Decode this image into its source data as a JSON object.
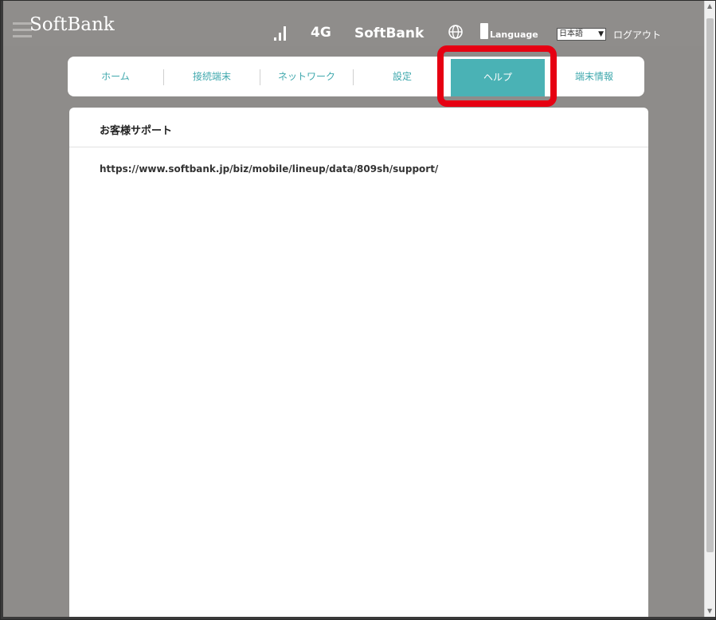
{
  "header": {
    "brand": "SoftBank",
    "network_type": "4G",
    "carrier": "SoftBank",
    "language_label": "Language",
    "language_selected": "日本語",
    "logout_label": "ログアウト"
  },
  "tabs": [
    {
      "label": "ホーム"
    },
    {
      "label": "接続端末"
    },
    {
      "label": "ネットワーク"
    },
    {
      "label": "設定"
    },
    {
      "label": "ヘルプ",
      "active": true
    },
    {
      "label": "端末情報"
    }
  ],
  "panel": {
    "title": "お客様サポート",
    "url": "https://www.softbank.jp/biz/mobile/lineup/data/809sh/support/"
  },
  "colors": {
    "header_bg": "#8f8d8b",
    "accent": "#4ab2b5",
    "highlight": "#e60012"
  }
}
